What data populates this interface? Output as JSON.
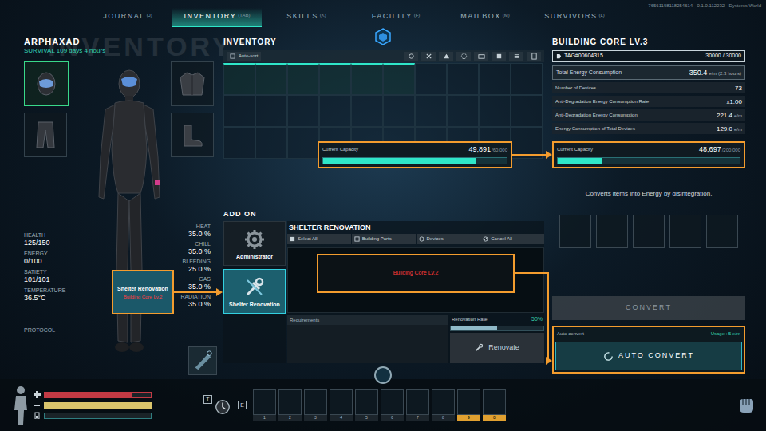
{
  "build_info": "76561198118254614 · 0.1.0.112232 · Dystems World",
  "tabs": [
    {
      "label": "JOURNAL",
      "key": "(J)",
      "selected": false
    },
    {
      "label": "INVENTORY",
      "key": "(TAB)",
      "selected": true
    },
    {
      "label": "SKILLS",
      "key": "(K)",
      "selected": false
    },
    {
      "label": "FACILITY",
      "key": "(F)",
      "selected": false
    },
    {
      "label": "MAILBOX",
      "key": "(M)",
      "selected": false
    },
    {
      "label": "SURVIVORS",
      "key": "(L)",
      "selected": false
    }
  ],
  "character": {
    "name": "ARPHAXAD",
    "survival": "SURVIVAL 109 days 4 hours",
    "watermark": "INVENTORY"
  },
  "equipment": [
    {
      "kind": "helmet",
      "selected": true
    },
    {
      "kind": "jacket",
      "selected": false
    },
    {
      "kind": "pants",
      "selected": false
    },
    {
      "kind": "boots",
      "selected": false
    }
  ],
  "stats": [
    {
      "label": "HEALTH",
      "value": "125/150"
    },
    {
      "label": "ENERGY",
      "value": "0/100"
    },
    {
      "label": "SATIETY",
      "value": "101/101"
    },
    {
      "label": "TEMPERATURE",
      "value": "36.5°C"
    }
  ],
  "protocol": "PROTOCOL",
  "resistances": [
    {
      "label": "HEAT",
      "value": "35.0 %"
    },
    {
      "label": "CHILL",
      "value": "35.0 %"
    },
    {
      "label": "BLEEDING",
      "value": "25.0 %"
    },
    {
      "label": "GAS",
      "value": "35.0 %"
    },
    {
      "label": "RADIATION",
      "value": "35.0 %"
    }
  ],
  "callout": {
    "title": "Shelter Renovation",
    "subtitle": "Building Core Lv.2"
  },
  "inventory": {
    "title": "INVENTORY",
    "auto_sort": "Auto-sort",
    "cells": [
      {
        "highlighted": true
      },
      {
        "highlighted": true
      },
      {
        "highlighted": true
      },
      {
        "highlighted": true
      },
      {
        "highlighted": true
      },
      {
        "highlighted": true
      },
      {
        "highlighted": false
      },
      {
        "highlighted": false
      },
      {
        "highlighted": false
      },
      {
        "highlighted": false
      },
      {
        "highlighted": false
      },
      {
        "highlighted": false
      },
      {
        "highlighted": false
      },
      {
        "highlighted": false
      },
      {
        "highlighted": false
      },
      {
        "highlighted": false
      },
      {
        "highlighted": false
      },
      {
        "highlighted": false
      },
      {
        "highlighted": false
      },
      {
        "highlighted": false
      },
      {
        "highlighted": false
      },
      {
        "highlighted": false
      },
      {
        "highlighted": false
      },
      {
        "highlighted": false
      },
      {
        "highlighted": false
      },
      {
        "highlighted": false
      },
      {
        "highlighted": false
      },
      {
        "highlighted": false
      },
      {
        "highlighted": false
      },
      {
        "highlighted": false
      }
    ]
  },
  "inventory_capacity": {
    "label": "Current Capacity",
    "value": "49,891",
    "max": "/60,000",
    "level": 0.83
  },
  "add_on": {
    "title": "ADD ON",
    "modules": [
      {
        "kind": "administrator",
        "label": "Administrator",
        "selected": false
      },
      {
        "kind": "renovation",
        "label": "Shelter Renovation",
        "selected": true
      }
    ]
  },
  "renovation": {
    "title": "SHELTER RENOVATION",
    "filters": [
      {
        "kind": "select",
        "label": "Select All"
      },
      {
        "kind": "parts",
        "label": "Building Parts"
      },
      {
        "kind": "devices",
        "label": "Devices"
      },
      {
        "kind": "cancel",
        "label": "Cancel All"
      }
    ],
    "items": [
      {
        "label": "Building Core Lv.2",
        "selected": false
      }
    ],
    "requirements": "Requirements",
    "rate_label": "Renovation Rate",
    "rate": "50%",
    "rate_level": 0.5,
    "action": "Renovate"
  },
  "core": {
    "title": "BUILDING CORE LV.3",
    "tag": "TAG#00604315",
    "durability": "30000 / 30000",
    "total": {
      "label": "Total Energy Consumption",
      "value": "350.4",
      "unit": "e/m (2.3 hours)"
    },
    "rows": [
      {
        "label": "Number of Devices",
        "value": "73"
      },
      {
        "label": "Anti-Degradation Energy Consumption Rate",
        "value": "x1.00"
      },
      {
        "label": "Anti-Degradation Energy Consumption",
        "value": "221.4",
        "unit": "e/m"
      },
      {
        "label": "Energy Consumption of Total Devices",
        "value": "129.0",
        "unit": "e/m"
      }
    ],
    "capacity": {
      "label": "Current Capacity",
      "value": "48,697",
      "max": "/200,000",
      "level": 0.24
    },
    "description": "Converts items into Energy by disintegration.",
    "slots": [
      {
        "filled": false
      },
      {
        "filled": false
      },
      {
        "filled": false
      },
      {
        "filled": false
      },
      {
        "filled": false
      }
    ],
    "convert": {
      "label": "CONVERT",
      "disabled": true
    },
    "auto_convert": {
      "label": "Auto-convert",
      "usage": "Usage : 5 e/m",
      "button": "AUTO CONVERT"
    }
  },
  "vitals": [
    {
      "level": 0.83,
      "color": "#c23a44"
    },
    {
      "level": 1,
      "color": "#d9c46c"
    },
    {
      "level": 0,
      "color": "#2f7d80"
    }
  ],
  "hotbar": {
    "keys": [
      {
        "label": "T"
      },
      {
        "label": "E"
      }
    ],
    "slots": [
      {
        "label": "1",
        "marked": false
      },
      {
        "label": "2",
        "marked": false
      },
      {
        "label": "3",
        "marked": false
      },
      {
        "label": "4",
        "marked": false
      },
      {
        "label": "5",
        "marked": false
      },
      {
        "label": "6",
        "marked": false
      },
      {
        "label": "7",
        "marked": false
      },
      {
        "label": "8",
        "marked": false
      },
      {
        "label": "9",
        "marked": true
      },
      {
        "label": "0",
        "marked": true
      }
    ]
  }
}
